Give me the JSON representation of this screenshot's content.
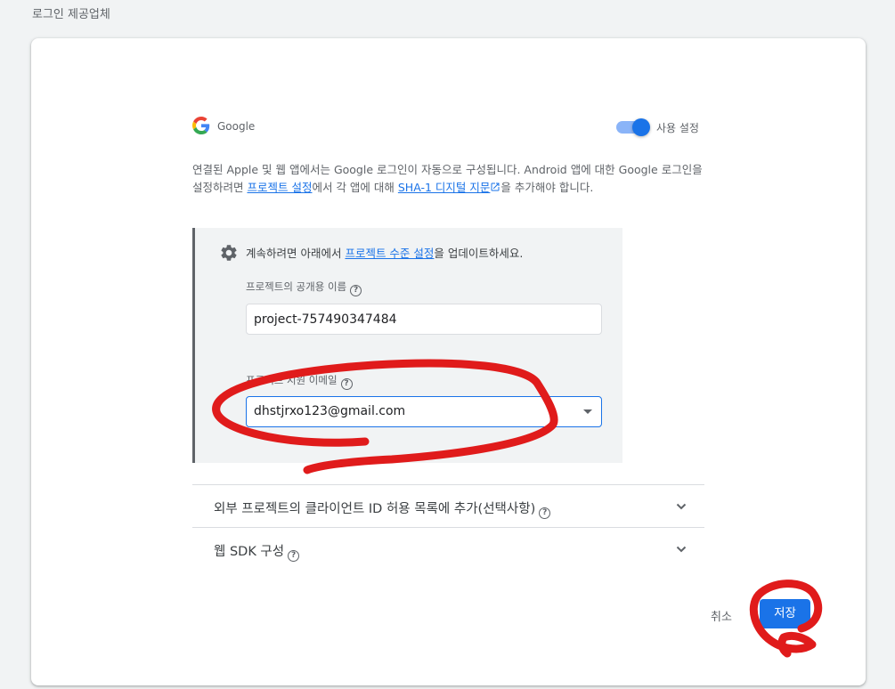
{
  "page": {
    "section_title": "로그인 제공업체"
  },
  "provider": {
    "name": "Google",
    "icon": "google-g-icon",
    "enabled": true,
    "toggle_label": "사용 설정"
  },
  "description": {
    "part1": "연결된 Apple 및 웹 앱에서는 Google 로그인이 자동으로 구성됩니다. Android 앱에 대한 Google 로그인을 설정하려면 ",
    "link1": "프로젝트 설정",
    "part2": "에서 각 앱에 대해 ",
    "link2": "SHA-1 디지털 지문",
    "part3": "을 추가해야 합니다."
  },
  "settings_box": {
    "text_before": "계속하려면 아래에서 ",
    "link": "프로젝트 수준 설정",
    "text_after": "을 업데이트하세요.",
    "public_name_label": "프로젝트의 공개용 이름",
    "public_name_value": "project-757490347484",
    "support_email_label": "프로젝트 지원 이메일",
    "support_email_value": "dhstjrxo123@gmail.com"
  },
  "expanders": [
    {
      "label": "외부 프로젝트의 클라이언트 ID 허용 목록에 추가(선택사항)"
    },
    {
      "label": "웹 SDK 구성"
    }
  ],
  "actions": {
    "cancel": "취소",
    "save": "저장"
  },
  "colors": {
    "primary": "#1a73e8",
    "annotation": "#e01b1b",
    "box_bg": "#f1f3f4"
  }
}
